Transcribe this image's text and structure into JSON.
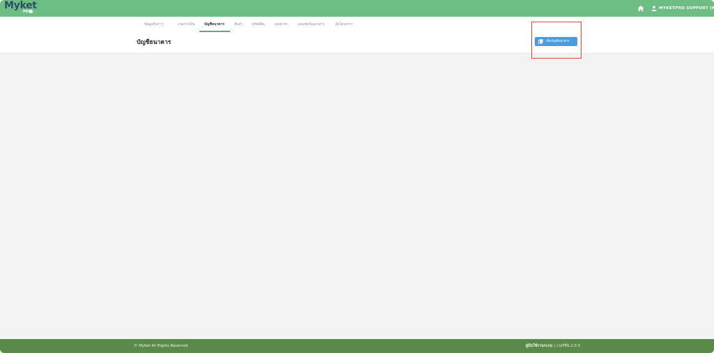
{
  "app": {
    "logo_main": "Myket",
    "logo_sub": "PRO"
  },
  "header": {
    "user_name": "MYKETPRO SUPPORT (P)"
  },
  "tabs": [
    {
      "label": "ข้อมูลกิจการ",
      "active": false
    },
    {
      "label": "งวดการเงิน",
      "active": false
    },
    {
      "label": "บัญชีธนาคาร",
      "active": true
    },
    {
      "label": "สินค้า",
      "active": false
    },
    {
      "label": "ทรัพย์สิน",
      "active": false
    },
    {
      "label": "บุคลากร",
      "active": false
    },
    {
      "label": "แบบฟอร์มเอกสาร",
      "active": false
    },
    {
      "label": "ผังโครงการ",
      "active": false
    }
  ],
  "page": {
    "title": "บัญชีธนาคาร",
    "add_button_label": "เพิ่มบัญชีธนาคาร"
  },
  "footer": {
    "copyright": "© MyKet All Rights Reserved",
    "manual_link": "คู่มือใช้งานระบบ",
    "separator": "|",
    "version": "เวอร์ชั่น 2.0.0"
  },
  "colors": {
    "topbar": "#6cbe85",
    "footer": "#5a8a49",
    "primary_button": "#4a9be0",
    "highlight": "#e0452d",
    "active_tab_underline": "#5dac73"
  },
  "icons": {
    "home": "home-icon",
    "user": "user-icon",
    "add": "add-document-icon"
  }
}
